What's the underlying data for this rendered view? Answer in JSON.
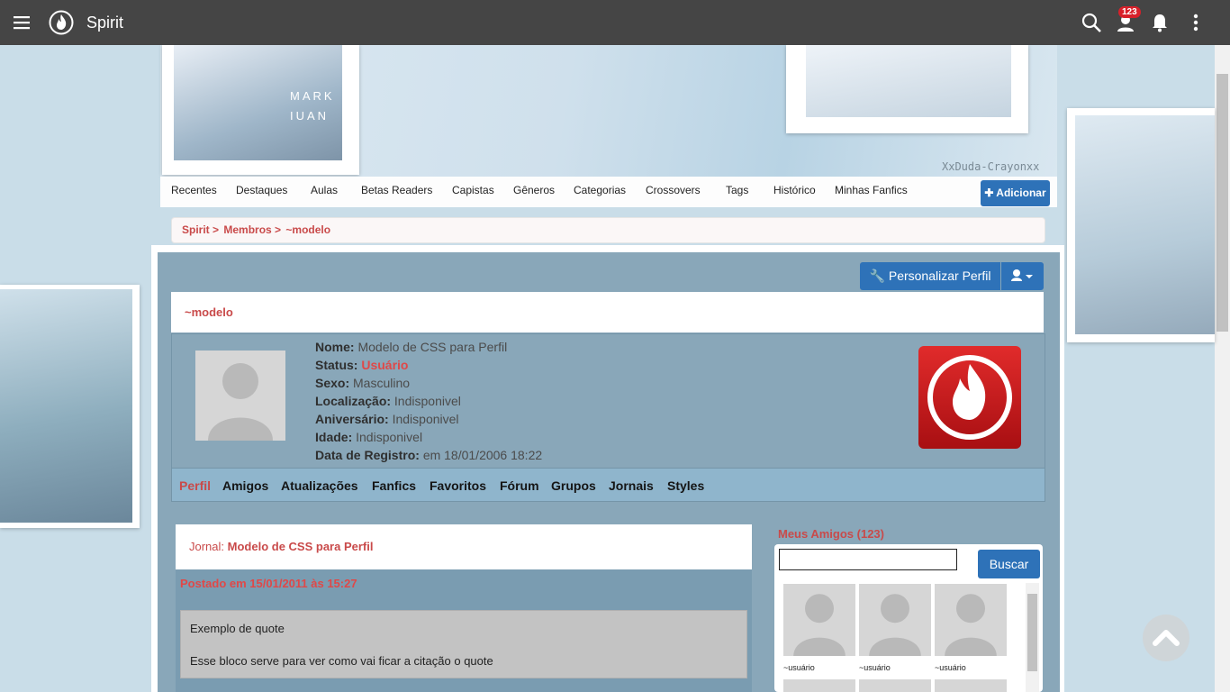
{
  "app": {
    "title": "Spirit",
    "notification_count": "123"
  },
  "icons": {
    "menu": "hamburger-icon",
    "logo": "flame-icon",
    "search": "search-icon",
    "user": "user-icon",
    "bell": "bell-icon",
    "more": "kebab-icon"
  },
  "banner": {
    "photo_text_1": "MARK",
    "photo_text_2": "IUAN",
    "watermark": "XxDuda-Crayonxx"
  },
  "nav": {
    "items": [
      "Recentes",
      "Destaques",
      "Aulas",
      "Betas Readers",
      "Capistas",
      "Gêneros",
      "Categorias",
      "Crossovers",
      "Tags",
      "Histórico",
      "Minhas Fanfics"
    ],
    "add_button": "Adicionar"
  },
  "breadcrumb": {
    "items": [
      "Spirit >",
      "Membros >",
      "~modelo"
    ]
  },
  "profile": {
    "customize_button": "Personalizar Perfil",
    "username": "~modelo",
    "fields": {
      "nome_label": "Nome:",
      "nome": "Modelo de CSS para Perfil",
      "status_label": "Status:",
      "status": "Usuário",
      "sexo_label": "Sexo:",
      "sexo": "Masculino",
      "localizacao_label": "Localização:",
      "localizacao": "Indisponivel",
      "aniversario_label": "Aniversário:",
      "aniversario": "Indisponivel",
      "idade_label": "Idade:",
      "idade": "Indisponivel",
      "registro_label": "Data de Registro:",
      "registro": "em 18/01/2006 18:22"
    },
    "tabs": [
      "Perfil",
      "Amigos",
      "Atualizações",
      "Fanfics",
      "Favoritos",
      "Fórum",
      "Grupos",
      "Jornais",
      "Styles"
    ],
    "active_tab": "Perfil"
  },
  "journal": {
    "prefix": "Jornal:",
    "title": "Modelo de CSS para Perfil",
    "posted": "Postado em 15/01/2011 às 15:27",
    "quote_line_1": "Exemplo de quote",
    "quote_line_2": "Esse bloco serve para ver como vai ficar a citação o quote"
  },
  "friends": {
    "title": "Meus Amigos (123)",
    "search_button": "Buscar",
    "search_value": "",
    "items": [
      "~usuário",
      "~usuário",
      "~usuário"
    ]
  },
  "colors": {
    "accent": "#2e72b8",
    "brand_red": "#c94a4a",
    "topbar": "#454545",
    "panel": "#89a7b9"
  }
}
